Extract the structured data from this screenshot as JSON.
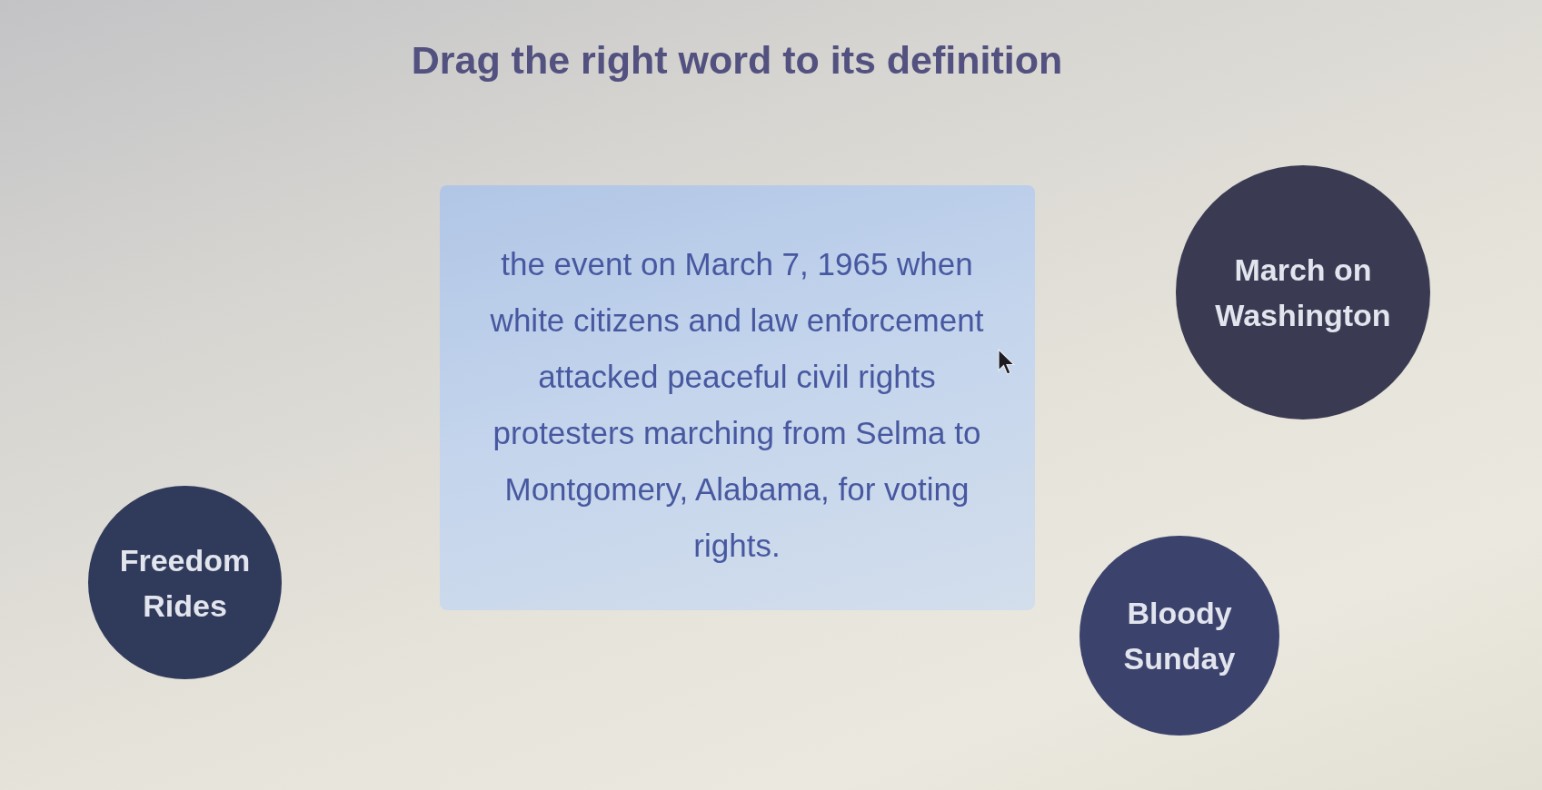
{
  "title": "Drag the right word to its definition",
  "definition": {
    "text": "the event on March 7, 1965 when white citizens and law enforcement attacked peaceful civil rights protesters marching from Selma to Montgomery, Alabama, for voting rights."
  },
  "words": [
    {
      "label": "March on Washington"
    },
    {
      "label": "Freedom Rides"
    },
    {
      "label": "Bloody Sunday"
    }
  ]
}
